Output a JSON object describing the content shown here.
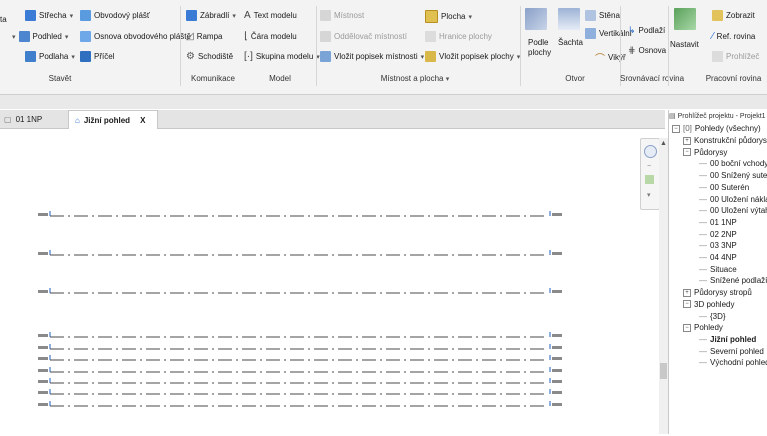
{
  "ribbon": {
    "build": {
      "label": "Stavět",
      "roof": "Střecha",
      "curtain_wall": "Obvodový plášť",
      "ceiling": "Podhled",
      "curtain_grid": "Osnova obvodového pláště",
      "floor": "Podlaha",
      "mullion": "Příčel",
      "cut_left": "ta"
    },
    "circulation": {
      "label": "Komunikace",
      "railing": "Zábradlí",
      "ramp": "Rampa",
      "stair": "Schodiště"
    },
    "model": {
      "label": "Model",
      "model_text": "Text modelu",
      "model_line": "Čára modelu",
      "model_group": "Skupina modelu"
    },
    "room_area": {
      "label": "Místnost a plocha",
      "room": "Místnost",
      "area": "Plocha",
      "room_separator": "Oddělovač místností",
      "area_boundary": "Hranice plochy",
      "tag_room": "Vložit popisek místnosti",
      "tag_area": "Vložit popisek plochy"
    },
    "opening": {
      "label": "Otvor",
      "by_face": "Podle plochy",
      "shaft": "Šachta",
      "wall": "Stěna",
      "vertical": "Vertikální",
      "dormer": "Vikýř"
    },
    "datum": {
      "label": "Srovnávací rovina",
      "level": "Podlaží",
      "grid": "Osnova"
    },
    "work_plane": {
      "label": "Pracovní rovina",
      "set": "Nastavit",
      "show": "Zobrazit",
      "ref_plane": "Ref. rovina",
      "viewer": "Prohlížeč"
    }
  },
  "tabs": [
    {
      "label": "01 1NP",
      "active": false
    },
    {
      "label": "Jižní pohled",
      "active": true
    }
  ],
  "tab_close": "X",
  "browser": {
    "title": "Prohlížeč projektu - Projekt1",
    "root": "Pohledy (všechny)",
    "items": [
      {
        "label": "Konstrukční půdorysy",
        "level": 1,
        "toggle": "+"
      },
      {
        "label": "Půdorysy",
        "level": 1,
        "toggle": "−"
      },
      {
        "label": "00 boční vchody",
        "level": 2
      },
      {
        "label": "00 Snížený suterén",
        "level": 2
      },
      {
        "label": "00 Suterén",
        "level": 2
      },
      {
        "label": "00 Uložení nákladu",
        "level": 2
      },
      {
        "label": "00 Uložení výtahu",
        "level": 2
      },
      {
        "label": "01 1NP",
        "level": 2
      },
      {
        "label": "02 2NP",
        "level": 2
      },
      {
        "label": "03 3NP",
        "level": 2
      },
      {
        "label": "04 4NP",
        "level": 2
      },
      {
        "label": "Situace",
        "level": 2
      },
      {
        "label": "Snížené podlaží",
        "level": 2
      },
      {
        "label": "Půdorysy stropů",
        "level": 1,
        "toggle": "+"
      },
      {
        "label": "3D pohledy",
        "level": 1,
        "toggle": "−"
      },
      {
        "label": "{3D}",
        "level": 2
      },
      {
        "label": "Pohledy",
        "level": 1,
        "toggle": "−"
      },
      {
        "label": "Jižní pohled",
        "level": 2,
        "bold": true
      },
      {
        "label": "Severní pohled",
        "level": 2
      },
      {
        "label": "Východní pohled",
        "level": 2
      }
    ]
  },
  "colors": {
    "ribbon_bg": "#f3f3f3",
    "level_line": "#4a4a4a",
    "level_head": "#1f5fbf",
    "accent": "#2b6fcf"
  }
}
